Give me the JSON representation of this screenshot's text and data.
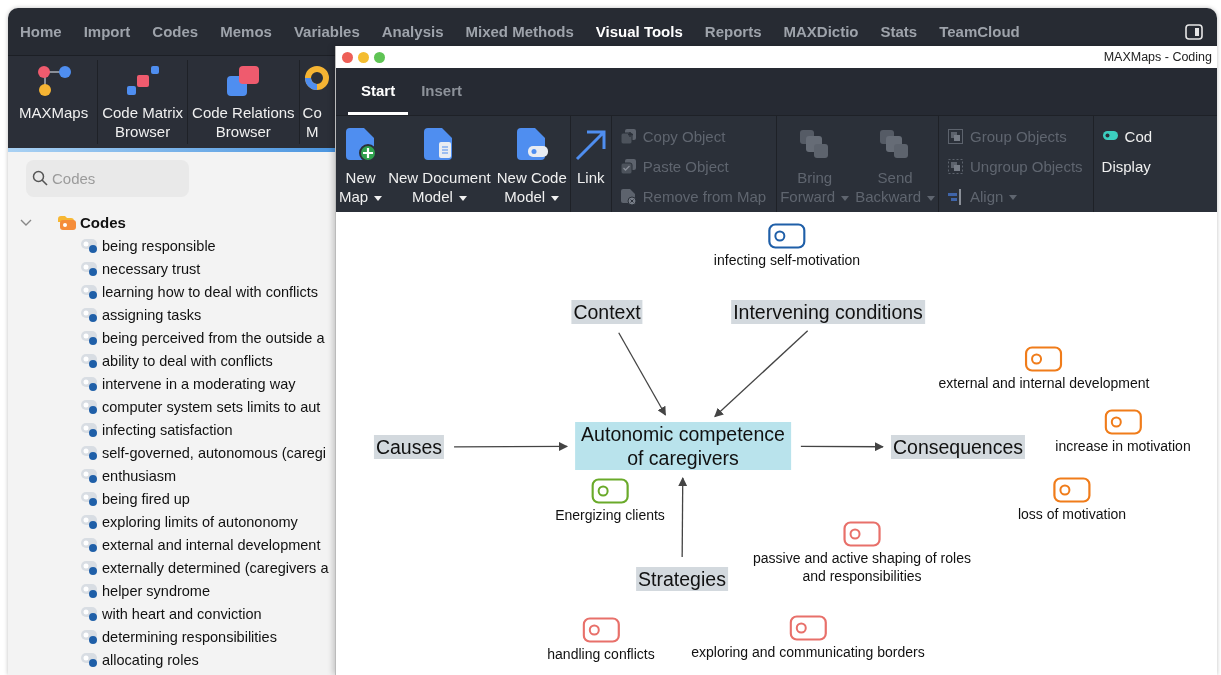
{
  "app": {
    "menu_tabs": [
      {
        "label": "Home",
        "selected": false
      },
      {
        "label": "Import",
        "selected": false
      },
      {
        "label": "Codes",
        "selected": false
      },
      {
        "label": "Memos",
        "selected": false
      },
      {
        "label": "Variables",
        "selected": false
      },
      {
        "label": "Analysis",
        "selected": false
      },
      {
        "label": "Mixed Methods",
        "selected": false
      },
      {
        "label": "Visual Tools",
        "selected": true
      },
      {
        "label": "Reports",
        "selected": false
      },
      {
        "label": "MAXDictio",
        "selected": false
      },
      {
        "label": "Stats",
        "selected": false
      },
      {
        "label": "TeamCloud",
        "selected": false
      }
    ],
    "ribbon": [
      {
        "label": "MAXMaps",
        "kind": "maxmaps"
      },
      {
        "label": "Code Matrix\nBrowser",
        "kind": "matrix"
      },
      {
        "label": "Code Relations\nBrowser",
        "kind": "relations"
      },
      {
        "label": "Co\nM",
        "kind": "donut"
      }
    ]
  },
  "code_system": {
    "search": {
      "placeholder": "Codes"
    },
    "tree": [
      {
        "label": "Codes",
        "expanded": true,
        "children": [
          {
            "label": "being responsible"
          },
          {
            "label": "necessary trust"
          },
          {
            "label": "learning how to deal with conflicts"
          },
          {
            "label": "assigning tasks"
          },
          {
            "label": "being perceived from the outside a"
          },
          {
            "label": "ability to deal with conflicts"
          },
          {
            "label": "intervene in a moderating way"
          },
          {
            "label": "computer system sets limits to aut"
          },
          {
            "label": "infecting satisfaction"
          },
          {
            "label": "self-governed, autonomous (caregi"
          },
          {
            "label": "enthusiasm"
          },
          {
            "label": "being fired up"
          },
          {
            "label": "exploring limits of autononomy"
          },
          {
            "label": "external and internal development"
          },
          {
            "label": "externally determined (caregivers a"
          },
          {
            "label": "helper syndrome"
          },
          {
            "label": "with heart and conviction"
          },
          {
            "label": "determining responsibilities"
          },
          {
            "label": "allocating roles"
          }
        ]
      }
    ]
  },
  "maps_window": {
    "title": "MAXMaps - Coding",
    "tabs": [
      {
        "label": "Start",
        "selected": true
      },
      {
        "label": "Insert",
        "selected": false
      }
    ],
    "toolbar": [
      {
        "kind": "large",
        "items": [
          {
            "label": "New\nMap",
            "dropdown": true,
            "disabled": false
          },
          {
            "label": "New Document\nModel",
            "dropdown": true,
            "disabled": false
          },
          {
            "label": "New Code\nModel",
            "dropdown": true,
            "disabled": false
          }
        ]
      },
      {
        "kind": "large",
        "items": [
          {
            "label": "Link",
            "dropdown": false,
            "disabled": false
          }
        ]
      },
      {
        "kind": "small",
        "items": [
          {
            "label": "Copy Object",
            "dropdown": false,
            "disabled": true
          },
          {
            "label": "Paste Object",
            "dropdown": false,
            "disabled": true
          },
          {
            "label": "Remove from Map",
            "dropdown": false,
            "disabled": true
          }
        ]
      },
      {
        "kind": "large",
        "items": [
          {
            "label": "Bring\nForward",
            "dropdown": true,
            "disabled": true
          },
          {
            "label": "Send\nBackward",
            "dropdown": true,
            "disabled": true
          }
        ]
      },
      {
        "kind": "small",
        "items": [
          {
            "label": "Group Objects",
            "dropdown": false,
            "disabled": true
          },
          {
            "label": "Ungroup Objects",
            "dropdown": false,
            "disabled": true
          },
          {
            "label": "Align",
            "dropdown": true,
            "disabled": true
          }
        ]
      },
      {
        "kind": "small",
        "items": [
          {
            "label": "Cod",
            "dropdown": false,
            "disabled": false
          },
          {
            "label": "Display",
            "dropdown": false,
            "disabled": false
          }
        ]
      }
    ],
    "canvas": {
      "nodes": [
        {
          "kind": "code",
          "label": "infecting self-motivation",
          "color": "#1f5fa8"
        },
        {
          "kind": "category",
          "label": "Context"
        },
        {
          "kind": "category",
          "label": "Intervening conditions"
        },
        {
          "kind": "code",
          "label": "external and internal development",
          "color": "#f07c1a"
        },
        {
          "kind": "category",
          "label": "Causes"
        },
        {
          "kind": "core",
          "label": "Autonomic competence\nof caregivers"
        },
        {
          "kind": "category",
          "label": "Consequences"
        },
        {
          "kind": "code",
          "label": "increase in motivation",
          "color": "#f07c1a"
        },
        {
          "kind": "code",
          "label": "Energizing clients",
          "color": "#6aaa2a"
        },
        {
          "kind": "code",
          "label": "loss of motivation",
          "color": "#f07c1a"
        },
        {
          "kind": "category",
          "label": "Strategies"
        },
        {
          "kind": "code",
          "label": "passive and active shaping of roles\nand responsibilities",
          "color": "#e8706a"
        },
        {
          "kind": "code",
          "label": "handling conflicts",
          "color": "#e8706a"
        },
        {
          "kind": "code",
          "label": "exploring and communicating borders",
          "color": "#e8706a"
        }
      ]
    }
  }
}
